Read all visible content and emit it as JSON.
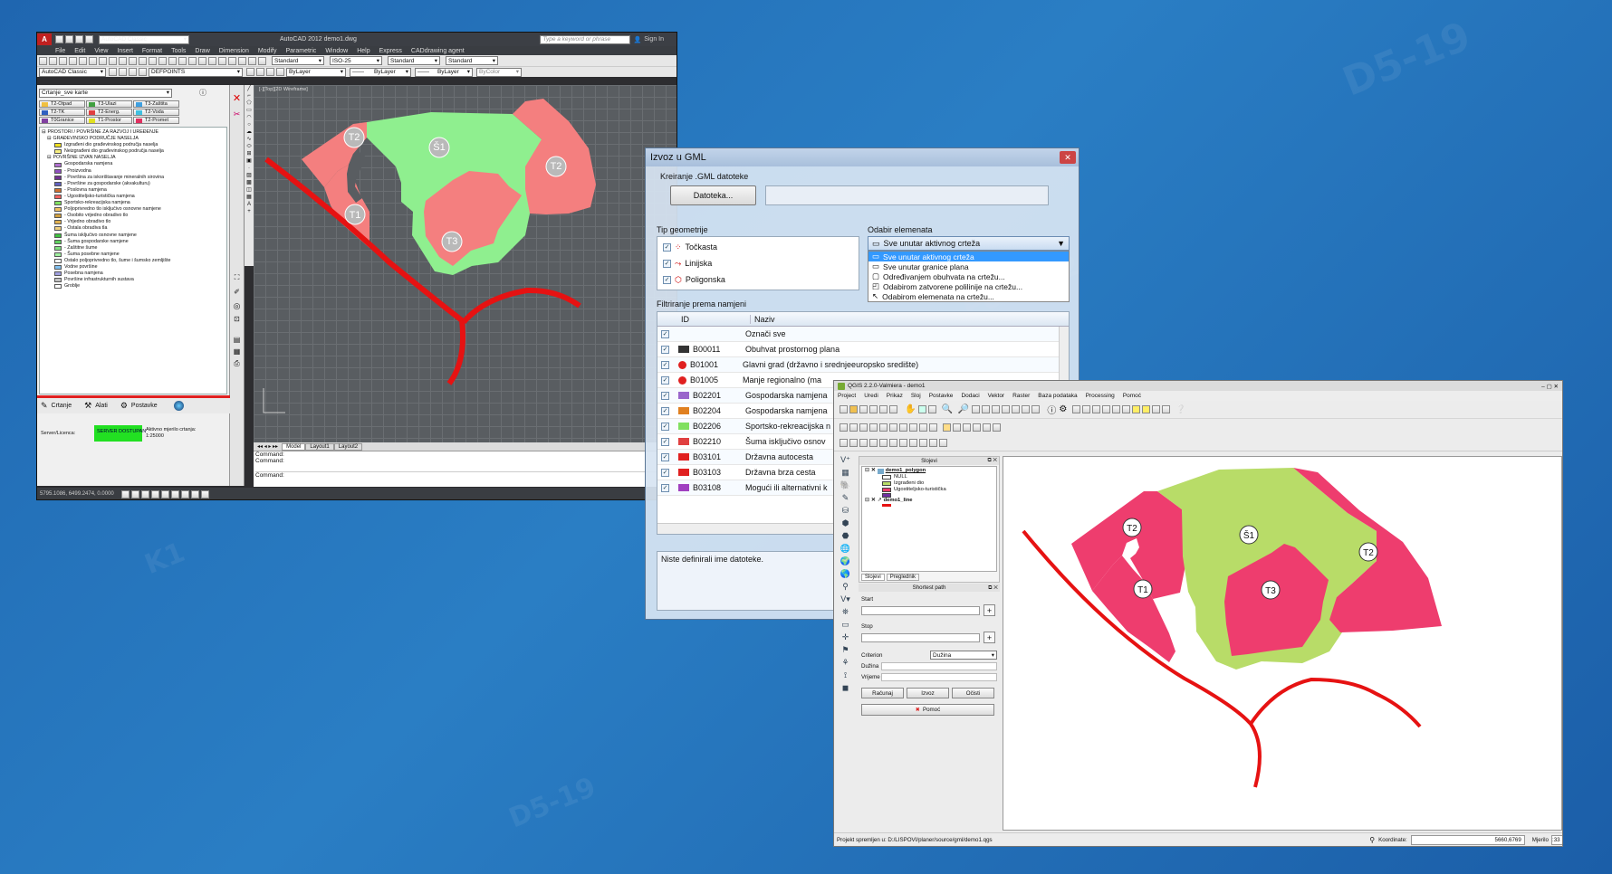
{
  "colors": {
    "pink": "#f47f7f",
    "green": "#8fef8f",
    "qpink": "#ee3d6e",
    "qgreen": "#b8dc68",
    "red": "#e61212"
  },
  "autocad": {
    "title": "AutoCAD 2012    demo1.dwg",
    "workspace": "AutoCAD Classic",
    "search_placeholder": "Type a keyword or phrase",
    "signin": "Sign In",
    "menu": [
      "File",
      "Edit",
      "View",
      "Insert",
      "Format",
      "Tools",
      "Draw",
      "Dimension",
      "Modify",
      "Parametric",
      "Window",
      "Help",
      "Express",
      "CADdrawing agent"
    ],
    "styles": [
      "Standard",
      "ISO-25",
      "Standard",
      "Standard"
    ],
    "layer": "DEFPOINTS",
    "bylayer": [
      "ByLayer",
      "ByLayer",
      "ByLayer",
      "ByColor"
    ],
    "viewport_label": "[-][Top][2D Wireframe]",
    "tabs": [
      "Model",
      "Layout1",
      "Layout2"
    ],
    "command_lines": [
      "Command:",
      "Command:",
      "Command:"
    ],
    "coords": "5795.1086, 6499.2474, 0.0000",
    "palette": {
      "dropdown": "Crtanje_sve karte",
      "buttons": [
        "T2-Otpad",
        "T3-Ulazi",
        "T3-Zaštita",
        "T2-TK",
        "T2-Energ.",
        "T2-Voda",
        "T0Granice",
        "T1-Prostor",
        "T2-Promet"
      ],
      "tree_root": "PROSTORI / POVRŠINE ZA RAZVOJ I UREĐENJE",
      "tree_sub1": "GRAĐEVINSKO PODRUČJE NASELJA",
      "tree_sub2": "POVRŠINE IZVAN NASELJA",
      "tree_items": [
        {
          "label": "Izgrađeni dio građevinskog područja naselja",
          "color": "#f0e020"
        },
        {
          "label": "Neizgrađeni dio građevinskog područja naselja",
          "color": "#f8f080"
        },
        {
          "label": "Gospodarska namjena",
          "color": "#b070d0"
        },
        {
          "label": "- Proizvodna",
          "color": "#9050c0"
        },
        {
          "label": "- Površina za iskorištavanje mineralnih sirovina",
          "color": "#703090"
        },
        {
          "label": "- Površine za gospodarske (akvakulturu)",
          "color": "#6060c0"
        },
        {
          "label": "- Poslovna namjena",
          "color": "#d07030"
        },
        {
          "label": "- Ugostiteljsko-turistička namjena",
          "color": "#f06060"
        },
        {
          "label": "Sportsko-rekreacijska namjena",
          "color": "#80e060"
        },
        {
          "label": "Poljoprivredno tlo isključivo osnovne namjene",
          "color": "#f0c060"
        },
        {
          "label": "- Osobito vrijedno obradivo tlo",
          "color": "#d0a040"
        },
        {
          "label": "- Vrijedno obradivo tlo",
          "color": "#e0b050"
        },
        {
          "label": "- Ostala obradiva tla",
          "color": "#f0d080"
        },
        {
          "label": "Šuma isključivo osnovne namjene",
          "color": "#40c040"
        },
        {
          "label": "- Šuma gospodarske namjene",
          "color": "#60d060"
        },
        {
          "label": "- Zaštitne šume",
          "color": "#80e080"
        },
        {
          "label": "- Šuma posebne namjene",
          "color": "#a0f0a0"
        },
        {
          "label": "Ostalo poljoprivredno tlo, šume i šumsko zemljište",
          "color": "#ffffff"
        },
        {
          "label": "Vodne površine",
          "color": "#80c0f0"
        },
        {
          "label": "Posebna namjena",
          "color": "#a0a0e0"
        },
        {
          "label": "Površine infrastrukturnih sustava",
          "color": "#c0c0c0"
        },
        {
          "label": "Groblje",
          "color": "#ffffff"
        }
      ],
      "bottom_tabs": [
        "Crtanje",
        "Alati",
        "Postavke"
      ],
      "server_label": "Server/Licenca:",
      "server_status": "SERVER DOSTUPAN",
      "scale_label": "Aktivno mjerilo crtanja:",
      "scale_value": "1:25000"
    },
    "labels": [
      "T2",
      "Š1",
      "T2",
      "T1",
      "T3"
    ]
  },
  "gml": {
    "title": "Izvoz u GML",
    "section": "Kreiranje .GML datoteke",
    "file_button": "Datoteka...",
    "geom_title": "Tip geometrije",
    "geom": [
      "Točkasta",
      "Linijska",
      "Poligonska"
    ],
    "select_title": "Odabir elemenata",
    "select_value": "Sve unutar aktivnog crteža",
    "select_options": [
      "Sve unutar aktivnog crteža",
      "Sve unutar granice plana",
      "Određivanjem obuhvata na crtežu...",
      "Odabirom zatvorene polilinije na crtežu...",
      "Odabirom elemenata na crtežu..."
    ],
    "filter_title": "Filtriranje prema namjeni",
    "col_id": "ID",
    "col_name": "Naziv",
    "rows": [
      {
        "id": "",
        "name": "Označi sve",
        "color": ""
      },
      {
        "id": "B00011",
        "name": "Obuhvat prostornog plana",
        "color": "#333"
      },
      {
        "id": "B01001",
        "name": "Glavni grad (državno i srednjeeuropsko središte)",
        "color": "#e02020"
      },
      {
        "id": "B01005",
        "name": "Manje regionalno (ma",
        "color": "#e02020"
      },
      {
        "id": "B02201",
        "name": "Gospodarska namjena",
        "color": "#9966cc"
      },
      {
        "id": "B02204",
        "name": "Gospodarska namjena",
        "color": "#e08020"
      },
      {
        "id": "B02206",
        "name": "Sportsko-rekreacijska n",
        "color": "#80e060"
      },
      {
        "id": "B02210",
        "name": "Šuma isključivo osnov",
        "color": "#e04040"
      },
      {
        "id": "B03101",
        "name": "Državna autocesta",
        "color": "#e02020"
      },
      {
        "id": "B03103",
        "name": "Državna brza cesta",
        "color": "#e02020"
      },
      {
        "id": "B03108",
        "name": "Mogući ili alternativni k",
        "color": "#a040c0"
      }
    ],
    "status": "Niste definirali ime datoteke."
  },
  "qgis": {
    "title": "QGIS 2.2.0-Valmiera - demo1",
    "menu": [
      "Project",
      "Uredi",
      "Prikaz",
      "Sloj",
      "Postavke",
      "Dodaci",
      "Vektor",
      "Raster",
      "Baza podataka",
      "Processing",
      "Pomoć"
    ],
    "layers_title": "Slojevi",
    "layer1": "demo1_polygon",
    "layer1_items": [
      "NULL",
      "Izgrađeni dio",
      "Ugostiteljsko-turistička"
    ],
    "layer2": "demo1_line",
    "tabs": [
      "Slojevi",
      "Preglednik"
    ],
    "sp_title": "Shortest path",
    "start": "Start",
    "stop": "Stop",
    "criterion": "Criterion",
    "criterion_value": "Dužina",
    "duzina": "Dužina",
    "vrijeme": "Vrijeme",
    "buttons": [
      "Računaj",
      "Izvoz",
      "Očisti"
    ],
    "help": "Pomoć",
    "status": "Projekt spremljen u: D:/LISPOVI/planer/source/gml/demo1.qgs",
    "coord_label": "Koordinate:",
    "coord_value": "5660,6769",
    "scale_label": "Mjerilo",
    "scale_value": ":33",
    "labels": [
      "T2",
      "Š1",
      "T2",
      "T1",
      "T3"
    ]
  }
}
